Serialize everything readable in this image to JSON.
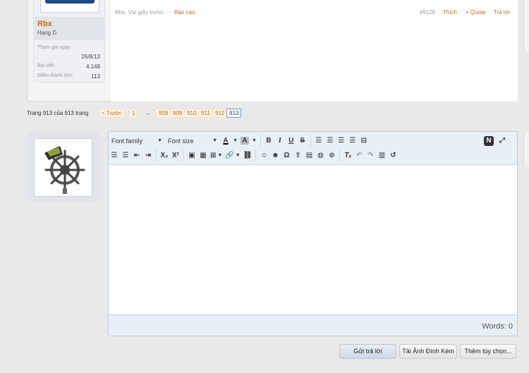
{
  "post": {
    "username": "Rbx",
    "rank": "Hạng D",
    "stats": [
      {
        "label": "Tham gia ngày:",
        "value": "26/8/13"
      },
      {
        "label": "Bài viết:",
        "value": "4.148"
      },
      {
        "label": "Điểm thành tích:",
        "value": "113"
      }
    ],
    "meta_time": "Rbx, Vài giây trước",
    "report": "Báo cáo",
    "post_number": "#9126",
    "like": "Thích",
    "quote": "+ Quote",
    "reply": "Trả lời"
  },
  "pagination": {
    "info": "Trang 913 của 913 trang",
    "prev": "< Trước",
    "first": "1",
    "arrow": "←",
    "pages": [
      "908",
      "909",
      "910",
      "911",
      "912",
      "913"
    ],
    "current": "913"
  },
  "editor": {
    "font_family": "Font family",
    "font_size": "Font size",
    "words": "Words: 0",
    "row1_icons": [
      "text-color-icon",
      "bg-color-icon",
      "bold-icon",
      "italic-icon",
      "underline-icon",
      "strikethrough-icon",
      "align-left-icon",
      "align-center-icon",
      "align-right-icon",
      "justify-icon",
      "horizontal-rule-icon",
      "toggle-source-icon",
      "fullscreen-icon"
    ],
    "row2_icons": [
      "bullet-list-icon",
      "numbered-list-icon",
      "outdent-icon",
      "indent-icon",
      "subscript-icon",
      "superscript-icon",
      "image-icon",
      "media-icon",
      "table-icon",
      "link-icon",
      "unlink-icon",
      "smiley-icon",
      "emoji-icon",
      "special-char-icon",
      "upload-icon",
      "template-icon",
      "spoiler-icon",
      "hide-icon",
      "clear-format-icon",
      "undo-icon",
      "redo-icon",
      "paste-icon",
      "restore-draft-icon"
    ]
  },
  "buttons": {
    "submit": "Gửi trả lời",
    "attach": "Tải Ảnh Đính Kèm",
    "more": "Thêm tùy chọn..."
  }
}
